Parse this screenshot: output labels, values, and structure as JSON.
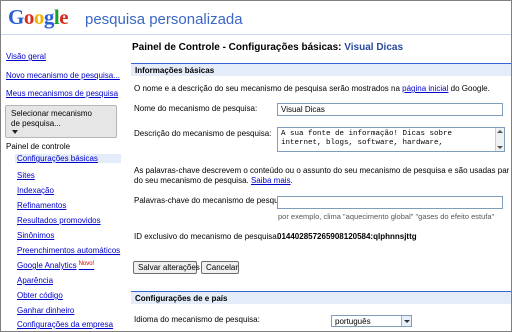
{
  "header": {
    "logo": [
      "G",
      "o",
      "o",
      "g",
      "l",
      "e"
    ],
    "app_title": "pesquisa personalizada"
  },
  "sidebar": {
    "links": [
      "Visão geral",
      "Novo mecanismo de pesquisa...",
      "Meus mecanismos de pesquisa"
    ],
    "selector_label": "Selecionar mecanismo de pesquisa...",
    "panel_label": "Painel de controle",
    "nav": [
      {
        "label": "Configurações básicas",
        "active": true
      },
      {
        "label": "Sites"
      },
      {
        "label": "Indexação"
      },
      {
        "label": "Refinamentos"
      },
      {
        "label": "Resultados promovidos"
      },
      {
        "label": "Sinônimos"
      },
      {
        "label": "Preenchimentos automáticos"
      },
      {
        "label": "Google Analytics",
        "badge": "Novo!"
      },
      {
        "label": "Aparência"
      },
      {
        "label": "Obter código"
      },
      {
        "label": "Ganhar dinheiro"
      },
      {
        "label": "Configurações da empresa"
      }
    ]
  },
  "main": {
    "title": "Painel de Controle - Configurações básicas:",
    "title_engine": "Visual Dicas",
    "section_basic": "Informações básicas",
    "description_before": "O nome e a descrição do seu mecanismo de pesquisa serão mostrados na ",
    "description_link": "página inicial",
    "description_after": " do Google.",
    "name_label": "Nome do mecanismo de pesquisa:",
    "name_value": "Visual Dicas",
    "desc_label": "Descrição do mecanismo de pesquisa:",
    "desc_value": "A sua fonte de informação! Dicas sobre internet, blogs, software, hardware,",
    "keywords_text_1": "As palavras-chave descrevem o conteúdo ou o assunto do seu mecanismo de pesquisa e são usadas para ajustar os resultados",
    "keywords_text_2": "do seu mecanismo de pesquisa. ",
    "keywords_link": "Saiba mais",
    "keywords_text_3": ".",
    "keywords_label": "Palavras-chave do mecanismo de pesquisa:",
    "keywords_value": "",
    "keywords_hint": "por exemplo, clima \"aquecimento global\" \"gases do efeito estufa\"",
    "id_label": "ID exclusivo do mecanismo de pesquisa:",
    "id_value": "014402857265908120584:qlphnnsjttg",
    "save_button": "Salvar alterações",
    "cancel_button": "Cancelar",
    "section_lang": "Configurações de e país",
    "lang_label": "Idioma do mecanismo de pesquisa:",
    "lang_value": "português"
  }
}
